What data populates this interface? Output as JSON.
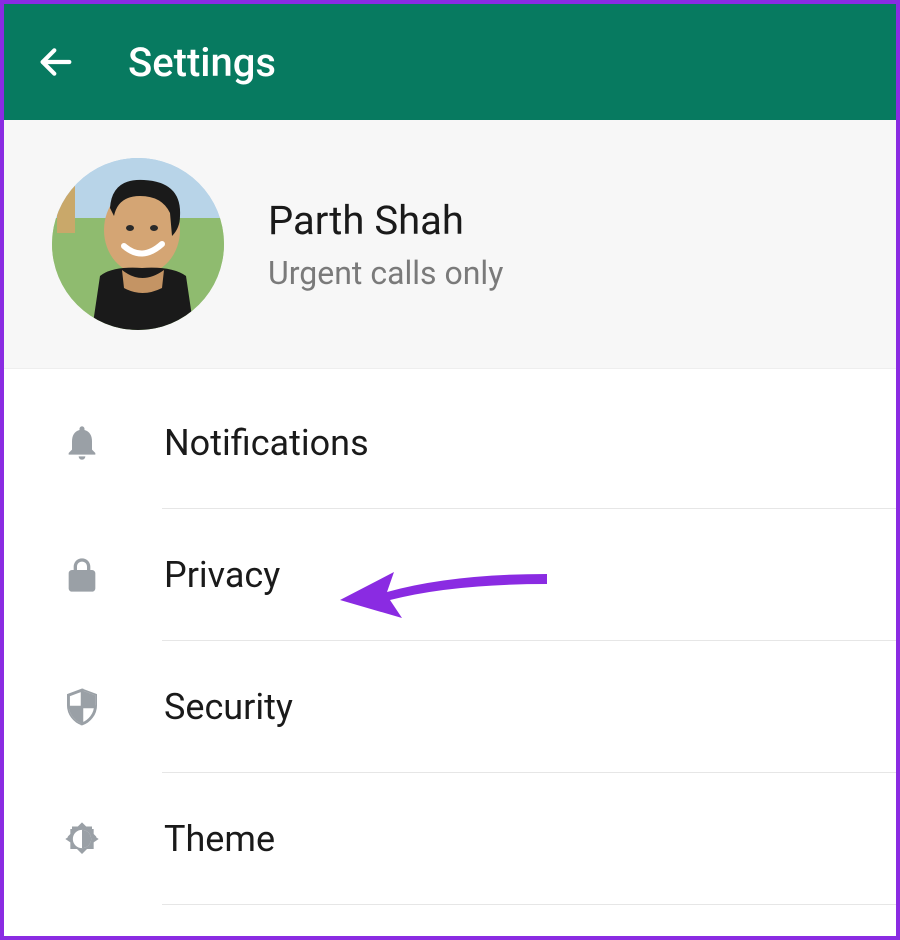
{
  "header": {
    "title": "Settings"
  },
  "profile": {
    "name": "Parth Shah",
    "status": "Urgent calls only"
  },
  "menu": {
    "items": [
      {
        "label": "Notifications",
        "icon": "bell-icon"
      },
      {
        "label": "Privacy",
        "icon": "lock-icon"
      },
      {
        "label": "Security",
        "icon": "shield-icon"
      },
      {
        "label": "Theme",
        "icon": "brightness-icon"
      }
    ]
  },
  "colors": {
    "header_bg": "#077a60",
    "annotation": "#8a2be2",
    "icon": "#9aa0a6"
  }
}
